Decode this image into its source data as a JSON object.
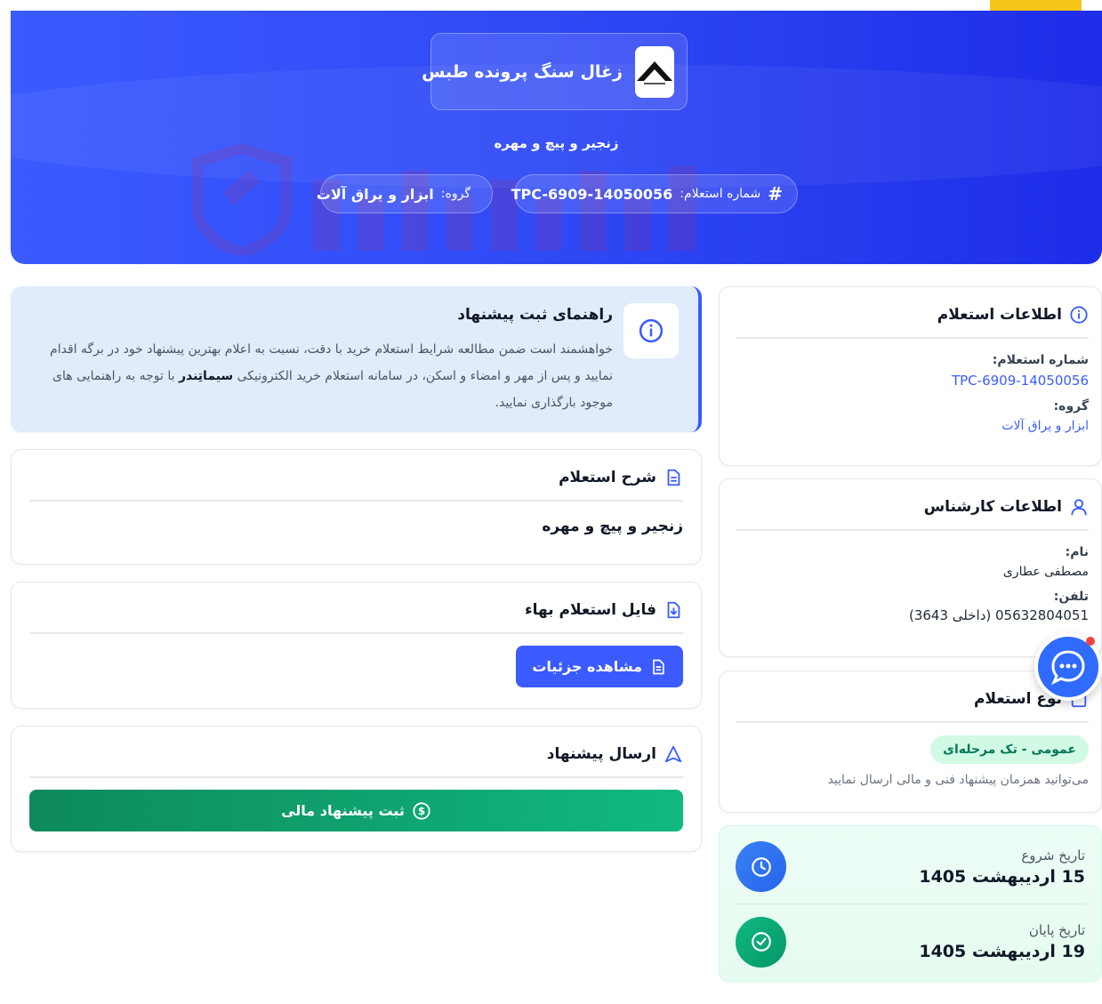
{
  "company": {
    "name": "زغال سنگ پرونده طبس"
  },
  "hero": {
    "subtitle": "زنجیر و پیچ و مهره",
    "number_label": "شماره استعلام:",
    "number_value": "TPC-6909-14050056",
    "group_label": "گروه:",
    "group_value": "ابزار و یراق آلات"
  },
  "info_card": {
    "title": "اطلاعات استعلام",
    "number_label": "شماره استعلام:",
    "number_value": "TPC-6909-14050056",
    "group_label": "گروه:",
    "group_value": "ابزار و یراق آلات"
  },
  "expert_card": {
    "title": "اطلاعات کارشناس",
    "name_label": "نام:",
    "name_value": "مصطفی عطاری",
    "phone_label": "تلفن:",
    "phone_value": "05632804051 (داخلی 3643)"
  },
  "type_card": {
    "title": "نوع استعلام",
    "badge": "عمومی - تک مرحله‌ای",
    "note": "می‌توانید همزمان پیشنهاد فنی و مالی ارسال نمایید"
  },
  "dates": {
    "start_label": "تاریخ شروع",
    "start_value": "15 اردیبهشت 1405",
    "end_label": "تاریخ پایان",
    "end_value": "19 اردیبهشت 1405"
  },
  "guide": {
    "title": "راهنمای ثبت پیشنهاد",
    "text_1": "خواهشمند است ضمن مطالعه شرایط استعلام خرید با دقت، نسبت به اعلام بهترین پیشنهاد خود در برگه اقدام نمایید و پس از مهر و امضاء و اسکن، در سامانه استعلام خرید الکترونیکی ",
    "text_brand": "سیماتِندر",
    "text_2": " با توجه به راهنمایی های موجود بارگذاری نمایید."
  },
  "description": {
    "title": "شرح استعلام",
    "body": "زنجیر و پیچ و مهره"
  },
  "file": {
    "title": "فایل استعلام بهاء",
    "button": "مشاهده جزئیات"
  },
  "send": {
    "title": "ارسال پیشنهاد",
    "button": "ثبت پیشنهاد مالی"
  },
  "colors": {
    "primary": "#3b5bff",
    "success": "#10b981",
    "hero_dark": "#1e2de8"
  }
}
